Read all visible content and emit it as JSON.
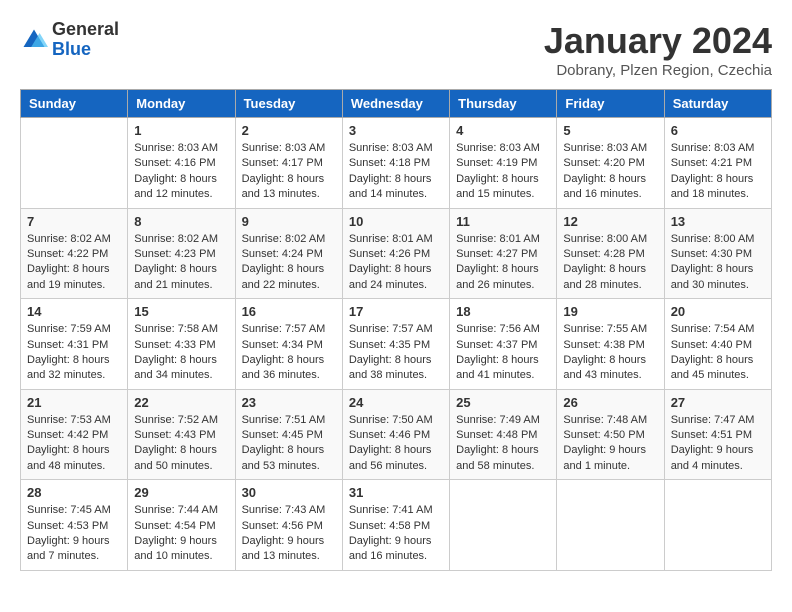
{
  "header": {
    "logo_general": "General",
    "logo_blue": "Blue",
    "month_title": "January 2024",
    "subtitle": "Dobrany, Plzen Region, Czechia"
  },
  "weekdays": [
    "Sunday",
    "Monday",
    "Tuesday",
    "Wednesday",
    "Thursday",
    "Friday",
    "Saturday"
  ],
  "weeks": [
    [
      {
        "day": "",
        "info": ""
      },
      {
        "day": "1",
        "info": "Sunrise: 8:03 AM\nSunset: 4:16 PM\nDaylight: 8 hours\nand 12 minutes."
      },
      {
        "day": "2",
        "info": "Sunrise: 8:03 AM\nSunset: 4:17 PM\nDaylight: 8 hours\nand 13 minutes."
      },
      {
        "day": "3",
        "info": "Sunrise: 8:03 AM\nSunset: 4:18 PM\nDaylight: 8 hours\nand 14 minutes."
      },
      {
        "day": "4",
        "info": "Sunrise: 8:03 AM\nSunset: 4:19 PM\nDaylight: 8 hours\nand 15 minutes."
      },
      {
        "day": "5",
        "info": "Sunrise: 8:03 AM\nSunset: 4:20 PM\nDaylight: 8 hours\nand 16 minutes."
      },
      {
        "day": "6",
        "info": "Sunrise: 8:03 AM\nSunset: 4:21 PM\nDaylight: 8 hours\nand 18 minutes."
      }
    ],
    [
      {
        "day": "7",
        "info": "Sunrise: 8:02 AM\nSunset: 4:22 PM\nDaylight: 8 hours\nand 19 minutes."
      },
      {
        "day": "8",
        "info": "Sunrise: 8:02 AM\nSunset: 4:23 PM\nDaylight: 8 hours\nand 21 minutes."
      },
      {
        "day": "9",
        "info": "Sunrise: 8:02 AM\nSunset: 4:24 PM\nDaylight: 8 hours\nand 22 minutes."
      },
      {
        "day": "10",
        "info": "Sunrise: 8:01 AM\nSunset: 4:26 PM\nDaylight: 8 hours\nand 24 minutes."
      },
      {
        "day": "11",
        "info": "Sunrise: 8:01 AM\nSunset: 4:27 PM\nDaylight: 8 hours\nand 26 minutes."
      },
      {
        "day": "12",
        "info": "Sunrise: 8:00 AM\nSunset: 4:28 PM\nDaylight: 8 hours\nand 28 minutes."
      },
      {
        "day": "13",
        "info": "Sunrise: 8:00 AM\nSunset: 4:30 PM\nDaylight: 8 hours\nand 30 minutes."
      }
    ],
    [
      {
        "day": "14",
        "info": "Sunrise: 7:59 AM\nSunset: 4:31 PM\nDaylight: 8 hours\nand 32 minutes."
      },
      {
        "day": "15",
        "info": "Sunrise: 7:58 AM\nSunset: 4:33 PM\nDaylight: 8 hours\nand 34 minutes."
      },
      {
        "day": "16",
        "info": "Sunrise: 7:57 AM\nSunset: 4:34 PM\nDaylight: 8 hours\nand 36 minutes."
      },
      {
        "day": "17",
        "info": "Sunrise: 7:57 AM\nSunset: 4:35 PM\nDaylight: 8 hours\nand 38 minutes."
      },
      {
        "day": "18",
        "info": "Sunrise: 7:56 AM\nSunset: 4:37 PM\nDaylight: 8 hours\nand 41 minutes."
      },
      {
        "day": "19",
        "info": "Sunrise: 7:55 AM\nSunset: 4:38 PM\nDaylight: 8 hours\nand 43 minutes."
      },
      {
        "day": "20",
        "info": "Sunrise: 7:54 AM\nSunset: 4:40 PM\nDaylight: 8 hours\nand 45 minutes."
      }
    ],
    [
      {
        "day": "21",
        "info": "Sunrise: 7:53 AM\nSunset: 4:42 PM\nDaylight: 8 hours\nand 48 minutes."
      },
      {
        "day": "22",
        "info": "Sunrise: 7:52 AM\nSunset: 4:43 PM\nDaylight: 8 hours\nand 50 minutes."
      },
      {
        "day": "23",
        "info": "Sunrise: 7:51 AM\nSunset: 4:45 PM\nDaylight: 8 hours\nand 53 minutes."
      },
      {
        "day": "24",
        "info": "Sunrise: 7:50 AM\nSunset: 4:46 PM\nDaylight: 8 hours\nand 56 minutes."
      },
      {
        "day": "25",
        "info": "Sunrise: 7:49 AM\nSunset: 4:48 PM\nDaylight: 8 hours\nand 58 minutes."
      },
      {
        "day": "26",
        "info": "Sunrise: 7:48 AM\nSunset: 4:50 PM\nDaylight: 9 hours\nand 1 minute."
      },
      {
        "day": "27",
        "info": "Sunrise: 7:47 AM\nSunset: 4:51 PM\nDaylight: 9 hours\nand 4 minutes."
      }
    ],
    [
      {
        "day": "28",
        "info": "Sunrise: 7:45 AM\nSunset: 4:53 PM\nDaylight: 9 hours\nand 7 minutes."
      },
      {
        "day": "29",
        "info": "Sunrise: 7:44 AM\nSunset: 4:54 PM\nDaylight: 9 hours\nand 10 minutes."
      },
      {
        "day": "30",
        "info": "Sunrise: 7:43 AM\nSunset: 4:56 PM\nDaylight: 9 hours\nand 13 minutes."
      },
      {
        "day": "31",
        "info": "Sunrise: 7:41 AM\nSunset: 4:58 PM\nDaylight: 9 hours\nand 16 minutes."
      },
      {
        "day": "",
        "info": ""
      },
      {
        "day": "",
        "info": ""
      },
      {
        "day": "",
        "info": ""
      }
    ]
  ]
}
